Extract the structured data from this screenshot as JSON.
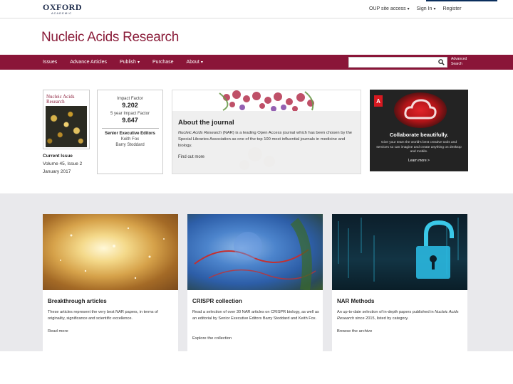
{
  "header": {
    "logo_main": "OXFORD",
    "logo_sub": "ACADEMIC",
    "links": [
      {
        "label": "OUP site access",
        "caret": "▾"
      },
      {
        "label": "Sign In",
        "caret": "▾"
      },
      {
        "label": "Register",
        "caret": ""
      }
    ]
  },
  "journal": {
    "title": "Nucleic Acids Research"
  },
  "nav": {
    "items": [
      {
        "label": "Issues",
        "caret": ""
      },
      {
        "label": "Advance Articles",
        "caret": ""
      },
      {
        "label": "Publish",
        "caret": "▾"
      },
      {
        "label": "Purchase",
        "caret": ""
      },
      {
        "label": "About",
        "caret": "▾"
      }
    ],
    "search_placeholder": "",
    "advanced_search_line1": "Advanced",
    "advanced_search_line2": "Search"
  },
  "cover": {
    "title_line1": "Nucleic Acids",
    "title_line2": "Research"
  },
  "current_issue": {
    "label": "Current Issue",
    "volume": "Volume 45, Issue 2",
    "date": "January 2017"
  },
  "metrics": {
    "impact_factor_label": "Impact Factor",
    "impact_factor_value": "9.202",
    "five_year_label": "5 year Impact Factor",
    "five_year_value": "9.647",
    "editors_title": "Senior Executive Editors",
    "editors": [
      "Keith Fox",
      "Barry Stoddard"
    ]
  },
  "about": {
    "title": "About the journal",
    "text_italic": "Nucleic Acids Research",
    "text_rest": " (NAR) is a leading Open Access journal which has been chosen by the Special Libraries Association as one of the top 100 most influential journals in medicine and biology.",
    "link": "Find out more"
  },
  "ad": {
    "logo_letter": "A",
    "headline": "Collaborate beautifully.",
    "text": "Give your team the world's best creative tools and services so can imagine and create anything on desktop and mobile.",
    "cta": "Learn more >"
  },
  "cards": [
    {
      "title": "Breakthrough articles",
      "text_before": "These articles represent the very best NAR papers, in terms of originality, significance and scientific excellence.",
      "text_italic": "",
      "text_after": "",
      "link": "Read more"
    },
    {
      "title": "CRISPR collection",
      "text_before": "Read a selection of over 30 NAR articles on CRISPR biology, as well as an editorial by Senior Executive Editors Barry Stoddard and Keith Fox.",
      "text_italic": "",
      "text_after": "",
      "link": "Explore the collection"
    },
    {
      "title": "NAR Methods",
      "text_before": "An up-to-date selection of in-depth papers published in ",
      "text_italic": "Nucleic Acids Research",
      "text_after": " since 2015, listed by category.",
      "link": "Browse the archive"
    }
  ],
  "colors": {
    "brand": "#8a1538",
    "title": "#8a1d3a",
    "lower_bg": "#e9e9ec"
  },
  "icons": [
    "search-icon",
    "adobe-logo-icon",
    "padlock-icon"
  ]
}
